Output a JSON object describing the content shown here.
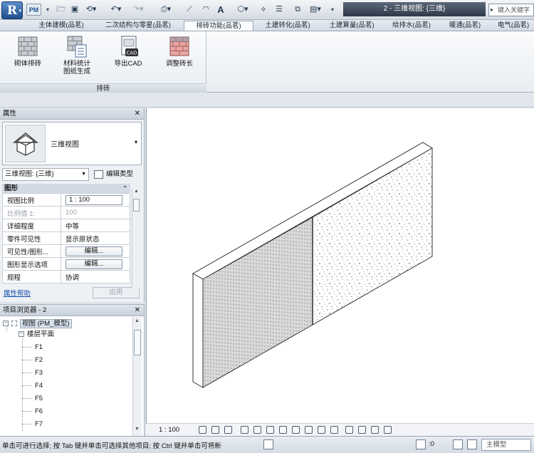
{
  "app": {
    "logo_letter": "R",
    "pm_badge": "PM",
    "window_title": "2 - 三维视图: {三维}",
    "help_search_placeholder": "键入关键字"
  },
  "tabs": [
    {
      "label": "主体建模(品茗)"
    },
    {
      "label": "二次结构与零星(品茗)"
    },
    {
      "label": "排砖功能(品茗)",
      "active": true
    },
    {
      "label": "土建转化(品茗)"
    },
    {
      "label": "土建算量(品茗)"
    },
    {
      "label": "给排水(品茗)"
    },
    {
      "label": "暖通(品茗)"
    },
    {
      "label": "电气(品茗)"
    }
  ],
  "ribbon": {
    "panel_title": "排砖",
    "buttons": [
      {
        "label": "砌体排砖",
        "icon": "brick-wall-icon"
      },
      {
        "label": "材料统计\n图纸生成",
        "icon": "material-stats-icon"
      },
      {
        "label": "导出CAD",
        "icon": "export-cad-icon"
      },
      {
        "label": "调整砖长",
        "icon": "adjust-brick-icon"
      }
    ]
  },
  "properties": {
    "title": "属性",
    "type_name": "三维视图",
    "instance_selector": "三维视图: {三维}",
    "edit_type_label": "编辑类型",
    "group_title": "图形",
    "rows": [
      {
        "key": "视图比例",
        "value": "1 : 100",
        "kind": "input"
      },
      {
        "key": "比例值 1:",
        "value": "100",
        "kind": "disabled"
      },
      {
        "key": "详细程度",
        "value": "中等",
        "kind": "text"
      },
      {
        "key": "零件可见性",
        "value": "显示原状态",
        "kind": "text"
      },
      {
        "key": "可见性/图形...",
        "value": "编辑...",
        "kind": "button"
      },
      {
        "key": "图形显示选项",
        "value": "编辑...",
        "kind": "button"
      },
      {
        "key": "规程",
        "value": "协调",
        "kind": "text"
      }
    ],
    "help_link": "属性帮助",
    "apply_label": "应用"
  },
  "browser": {
    "title": "项目浏览器 - 2",
    "root": "视图 (PM_模型)",
    "level_group": "楼层平面",
    "levels": [
      "F1",
      "F2",
      "F3",
      "F4",
      "F5",
      "F6",
      "F7"
    ]
  },
  "view_control": {
    "scale": "1 : 100"
  },
  "status": {
    "message": "单击可进行选择; 按 Tab 键并单击可选择其他项目; 按 Ctrl 键并单击可将新",
    "selection_count": ":0",
    "model_field": "主模型"
  },
  "colors": {
    "accent": "#1f4f8d",
    "title_bar": "#2e3948",
    "link": "#1a4fb0"
  }
}
